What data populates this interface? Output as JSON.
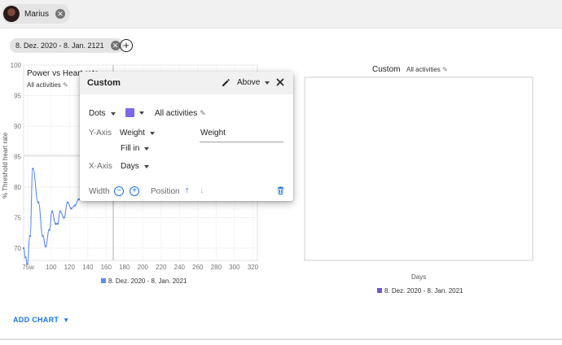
{
  "topbar": {
    "user_name": "Marius"
  },
  "date_range": {
    "label": "8. Dez. 2020 - 8. Jan. 2121",
    "close": "×",
    "add": "+"
  },
  "left_chart": {
    "title": "Power vs Heart rate",
    "subtitle": "All activities",
    "ylabel": "% Threshold heart rate",
    "legend": "8. Dez. 2020 - 8. Jan. 2021",
    "legend_color": "#5b8def"
  },
  "right_chart": {
    "title": "Custom",
    "subtitle": "All activities",
    "xlabel": "Days",
    "legend": "8. Dez. 2020 - 8. Jan. 2021",
    "legend_color": "#6a5acd"
  },
  "chart_data": [
    {
      "type": "line",
      "title": "Power vs Heart rate",
      "ylabel": "% Threshold heart rate",
      "x_tick_labels": [
        "75w",
        "100",
        "120",
        "140",
        "160",
        "180",
        "200",
        "220",
        "240",
        "260",
        "280",
        "300",
        "320"
      ],
      "y_tick_labels": [
        "70",
        "75",
        "80",
        "85",
        "90",
        "95",
        "100"
      ],
      "ylim": [
        68,
        100
      ],
      "xlim": [
        70,
        325
      ],
      "series": [
        {
          "name": "8. Dez. 2020 - 8. Jan. 2021",
          "color": "#5b8def",
          "x": [
            70,
            72,
            74,
            77,
            80,
            86,
            91,
            94,
            98,
            101,
            105,
            107,
            110,
            114,
            118,
            122,
            126,
            130,
            134,
            136
          ],
          "y": [
            70,
            68.5,
            67.5,
            72,
            83,
            77.5,
            72,
            70.3,
            73,
            76,
            74,
            74,
            76,
            75,
            77.5,
            76.5,
            77,
            78,
            78.5,
            79
          ]
        }
      ],
      "grid": true
    },
    {
      "type": "line",
      "title": "Custom",
      "xlabel": "Days",
      "series": []
    }
  ],
  "popup": {
    "title": "Custom",
    "position_value": "Above",
    "chart_type": "Dots",
    "swatch_color": "#7b68ee",
    "filter": "All activities",
    "y_axis_label": "Y-Axis",
    "y_axis_value": "Weight",
    "fill_value": "Fill in",
    "series_label": "Weight",
    "x_axis_label": "X-Axis",
    "x_axis_value": "Days",
    "width_label": "Width",
    "minus": "−",
    "plus": "+",
    "position_label": "Position",
    "arrow_up": "↑",
    "arrow_down": "↓"
  },
  "footer": {
    "add_chart": "ADD CHART"
  },
  "colors": {
    "accent": "#1a73e8",
    "line": "#5b8def"
  }
}
